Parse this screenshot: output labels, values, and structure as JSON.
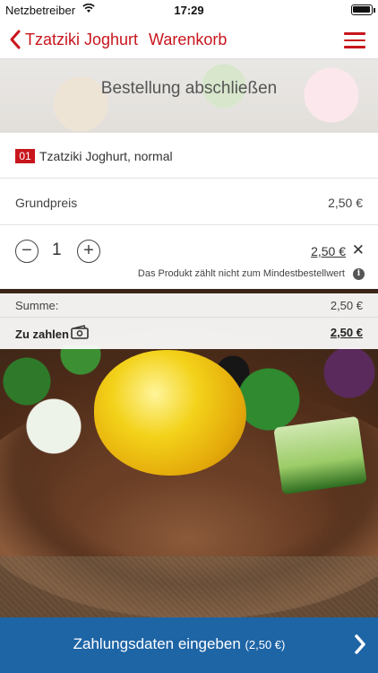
{
  "status_bar": {
    "carrier": "Netzbetreiber",
    "time": "17:29"
  },
  "nav": {
    "back_label": "Tzatziki Joghurt",
    "title": "Warenkorb"
  },
  "banner": {
    "heading": "Bestellung abschließen"
  },
  "cart_item": {
    "badge": "01",
    "name": "Tzatziki Joghurt, normal",
    "base_price_label": "Grundpreis",
    "base_price": "2,50 €",
    "quantity": "1",
    "price": "2,50 €",
    "remove_symbol": "✕",
    "note": "Das Produkt zählt nicht zum Mindestbestellwert"
  },
  "totals": {
    "sum_label": "Summe:",
    "sum_value": "2,50 €",
    "pay_label": "Zu zahlen",
    "pay_value": "2,50 €"
  },
  "cta": {
    "label": "Zahlungsdaten eingeben",
    "amount": "(2,50 €)"
  },
  "colors": {
    "accent_red": "#c8161d",
    "cta_blue": "#1e65a6"
  }
}
